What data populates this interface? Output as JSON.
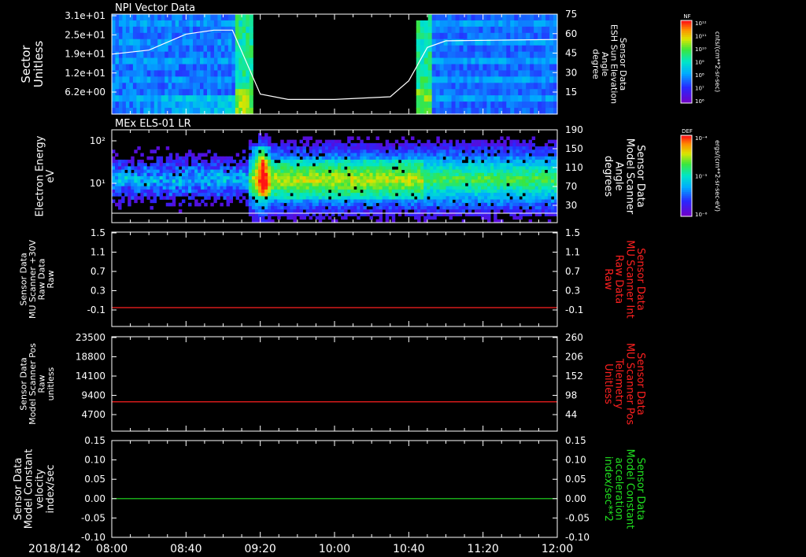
{
  "date_label": "2018/142",
  "x_ticks": [
    "08:00",
    "08:40",
    "09:20",
    "10:00",
    "10:40",
    "11:20",
    "12:00"
  ],
  "colors": {
    "red": "#ff2020",
    "green": "#20e020",
    "white": "#ffffff"
  },
  "chart_data": [
    {
      "type": "heatmap",
      "title": "NPI Vector Data",
      "ylabel": [
        "Sector",
        "Unitless"
      ],
      "yticks": [
        "3.1e+01",
        "2.5e+01",
        "1.9e+01",
        "1.2e+01",
        "6.2e+00"
      ],
      "y2label": [
        "Sensor Data",
        "ESH Sun Elevation",
        "Angle",
        "degree"
      ],
      "y2ticks": [
        "75",
        "60",
        "45",
        "30",
        "15"
      ],
      "colorbar": {
        "label": "NF",
        "unit": "cnts/(cm**2-sr-sec)",
        "ticks": [
          "10¹²",
          "10¹¹",
          "10¹⁰",
          "10⁹",
          "10⁸",
          "10⁷",
          "10⁶"
        ]
      },
      "overlay_line": {
        "name": "ESH Sun Elevation Angle",
        "x": [
          "08:00",
          "08:20",
          "08:40",
          "08:55",
          "09:05",
          "09:20",
          "09:35",
          "10:00",
          "10:30",
          "10:40",
          "10:50",
          "11:00",
          "12:00"
        ],
        "y": [
          45,
          48,
          60,
          63,
          63,
          15,
          11,
          11,
          13,
          25,
          50,
          55,
          56
        ]
      }
    },
    {
      "type": "heatmap",
      "title": "MEx ELS-01 LR",
      "ylabel": [
        "Electron Energy",
        "eV"
      ],
      "yticks": [
        "10²",
        "10¹"
      ],
      "y2label": [
        "Sensor Data",
        "Model Scanner",
        "Angle",
        "degrees"
      ],
      "y2ticks": [
        "190",
        "150",
        "110",
        "70",
        "30"
      ],
      "colorbar": {
        "label": "DEF",
        "unit": "ergs/(cm**2-sr-sec-eV)",
        "ticks": [
          "10⁻⁴",
          "10⁻⁵",
          "10⁻⁶"
        ]
      }
    },
    {
      "type": "line",
      "ylabel": [
        "Sensor Data",
        "MU Scanner +30V",
        "Raw Data",
        "Raw"
      ],
      "yticks": [
        "1.5",
        "1.1",
        "0.7",
        "0.3",
        "-0.1"
      ],
      "ylim": [
        -0.5,
        1.5
      ],
      "y2label": [
        "Sensor Data",
        "MU Scanner Int",
        "Raw Data",
        "Raw"
      ],
      "y2ticks": [
        "1.5",
        "1.1",
        "0.7",
        "0.3",
        "-0.1"
      ],
      "series": [
        {
          "values": [
            -0.1,
            -0.1
          ]
        }
      ]
    },
    {
      "type": "line",
      "ylabel": [
        "Sensor Data",
        "Model Scanner Pos",
        "Raw",
        "unitless"
      ],
      "yticks": [
        "23500",
        "18800",
        "14100",
        "9400",
        "4700"
      ],
      "ylim": [
        0,
        23500
      ],
      "y2label": [
        "Sensor Data",
        "MU Scanner Pos",
        "Telemetry",
        "Unitless"
      ],
      "y2ticks": [
        "260",
        "206",
        "152",
        "98",
        "44"
      ],
      "series": [
        {
          "values": [
            7300,
            7300
          ]
        }
      ]
    },
    {
      "type": "line",
      "ylabel": [
        "Sensor Data",
        "Model Constant",
        "velocity",
        "index/sec"
      ],
      "yticks": [
        "0.15",
        "0.10",
        "0.05",
        "0.00",
        "-0.05",
        "-0.10"
      ],
      "ylim": [
        -0.1,
        0.15
      ],
      "y2label": [
        "Sensor Data",
        "Model Constant",
        "acceleration",
        "index/sec**2"
      ],
      "y2ticks": [
        "0.15",
        "0.10",
        "0.05",
        "0.00",
        "-0.05",
        "-0.10"
      ],
      "series": [
        {
          "values": [
            0.0,
            0.0
          ]
        }
      ]
    }
  ]
}
